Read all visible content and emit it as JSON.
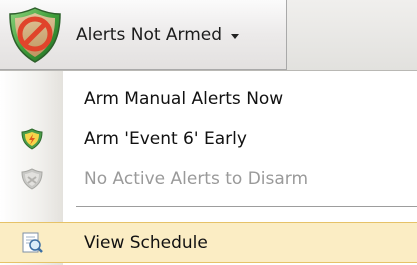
{
  "toolbar": {
    "alerts_button": {
      "label": "Alerts Not Armed",
      "icon": "shield-disarmed-icon"
    }
  },
  "menu": {
    "items": [
      {
        "label": "Arm Manual Alerts Now",
        "icon": "",
        "enabled": true
      },
      {
        "label": "Arm 'Event 6' Early",
        "icon": "shield-armed-icon",
        "enabled": true
      },
      {
        "label": "No Active Alerts to Disarm",
        "icon": "shield-disabled-icon",
        "enabled": false
      },
      {
        "label": "View Schedule",
        "icon": "schedule-icon",
        "enabled": true,
        "highlighted": true
      }
    ]
  },
  "colors": {
    "highlight_bg": "#fbedc4",
    "highlight_border": "#e6c268",
    "disabled_text": "#9a9a9a",
    "shield_green": "#3f9e3a",
    "no_sign_red": "#e0442b"
  }
}
